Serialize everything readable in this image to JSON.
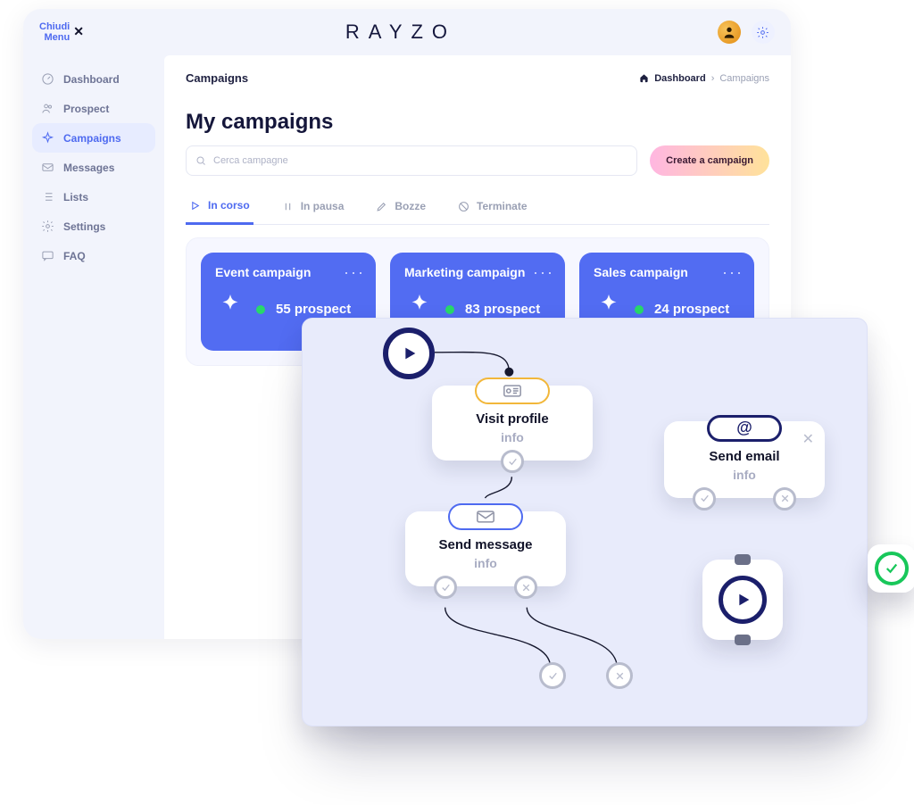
{
  "brand": "RAYZO",
  "close_menu": {
    "line1": "Chiudi",
    "line2": "Menu"
  },
  "sidebar": {
    "items": [
      {
        "label": "Dashboard",
        "icon": "gauge-icon"
      },
      {
        "label": "Prospect",
        "icon": "users-icon"
      },
      {
        "label": "Campaigns",
        "icon": "sparkle-icon",
        "active": true
      },
      {
        "label": "Messages",
        "icon": "mail-icon"
      },
      {
        "label": "Lists",
        "icon": "list-icon"
      },
      {
        "label": "Settings",
        "icon": "settings-icon"
      },
      {
        "label": "FAQ",
        "icon": "faq-icon"
      }
    ]
  },
  "breadcrumb": {
    "section": "Campaigns",
    "home": "Dashboard",
    "current": "Campaigns"
  },
  "page": {
    "title": "My campaigns"
  },
  "search": {
    "placeholder": "Cerca campagne"
  },
  "cta": {
    "label": "Create a campaign"
  },
  "tabs": [
    {
      "label": "In corso",
      "icon": "play-icon",
      "active": true
    },
    {
      "label": "In pausa",
      "icon": "pause-icon"
    },
    {
      "label": "Bozze",
      "icon": "pencil-icon"
    },
    {
      "label": "Terminate",
      "icon": "ban-icon"
    }
  ],
  "campaigns": [
    {
      "title": "Event campaign",
      "count": 55,
      "count_label": "55 prospect"
    },
    {
      "title": "Marketing campaign",
      "count": 83,
      "count_label": "83 prospect"
    },
    {
      "title": "Sales campaign",
      "count": 24,
      "count_label": "24 prospect"
    }
  ],
  "flow": {
    "nodes": {
      "visit_profile": {
        "title": "Visit profile",
        "sub": "info"
      },
      "send_message": {
        "title": "Send message",
        "sub": "info"
      },
      "send_email": {
        "title": "Send email",
        "sub": "info"
      }
    }
  },
  "colors": {
    "accent": "#4e6af0",
    "brand_dark": "#1b1f6b",
    "green": "#18c75a"
  }
}
